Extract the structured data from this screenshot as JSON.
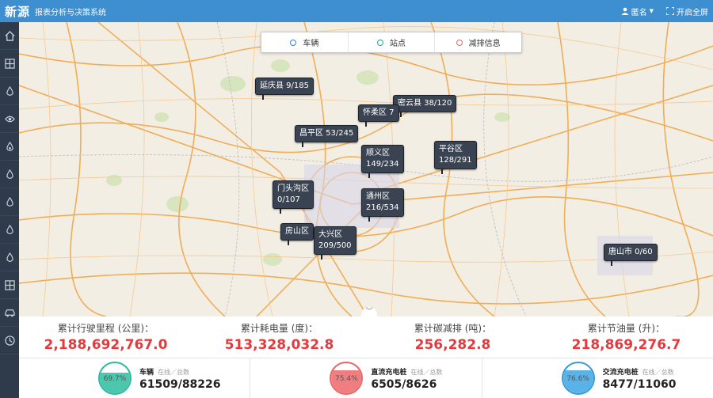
{
  "header": {
    "brand": "新源",
    "subtitle": "报表分析与决策系统",
    "user_label": "匿名",
    "fullscreen_label": "开启全屏"
  },
  "sidebar": {
    "items": [
      {
        "icon": "home-icon"
      },
      {
        "icon": "grid-icon"
      },
      {
        "icon": "drop-icon"
      },
      {
        "icon": "eye-icon"
      },
      {
        "icon": "drop-outline-icon"
      },
      {
        "icon": "drop-icon"
      },
      {
        "icon": "drop-icon"
      },
      {
        "icon": "drop-icon"
      },
      {
        "icon": "drop-icon"
      },
      {
        "icon": "grid-icon"
      },
      {
        "icon": "car-icon"
      },
      {
        "icon": "clock-icon"
      }
    ]
  },
  "legend": {
    "tabs": [
      {
        "label": "车辆",
        "color": "#3a7bd5"
      },
      {
        "label": "站点",
        "color": "#21a891"
      },
      {
        "label": "减排信息",
        "color": "#e8686a"
      }
    ]
  },
  "callouts": [
    {
      "line1": "延庆县 9/185",
      "line2": ""
    },
    {
      "line1": "密云县 38/120",
      "line2": ""
    },
    {
      "line1": "怀柔区 7",
      "line2": ""
    },
    {
      "line1": "昌平区 53/245",
      "line2": ""
    },
    {
      "line1": "顺义区",
      "line2": "149/234"
    },
    {
      "line1": "平谷区",
      "line2": "128/291"
    },
    {
      "line1": "门头沟区",
      "line2": "0/107"
    },
    {
      "line1": "通州区",
      "line2": "216/534"
    },
    {
      "line1": "房山区",
      "line2": ""
    },
    {
      "line1": "大兴区",
      "line2": "209/500"
    },
    {
      "line1": "唐山市 0/60",
      "line2": ""
    }
  ],
  "stats": [
    {
      "label": "累计行驶里程 (公里)：",
      "value": "2,188,692,767.0"
    },
    {
      "label": "累计耗电量 (度)：",
      "value": "513,328,032.8"
    },
    {
      "label": "累计碳减排 (吨)：",
      "value": "256,282.8"
    },
    {
      "label": "累计节油量 (升)：",
      "value": "218,869,276.7"
    }
  ],
  "cards": [
    {
      "title": "车辆",
      "sub": "在线／总数",
      "value": "61509/88226",
      "percent": "69.7%",
      "fill": 0.697,
      "color": "#2fb9a0",
      "fill_color": "#4cc7ae"
    },
    {
      "title": "直流充电桩",
      "sub": "在线／总数",
      "value": "6505/8626",
      "percent": "75.4%",
      "fill": 0.754,
      "color": "#e8686a",
      "fill_color": "#f07e80"
    },
    {
      "title": "交流充电桩",
      "sub": "在线／总数",
      "value": "8477/11060",
      "percent": "76.6%",
      "fill": 0.766,
      "color": "#3a9ad9",
      "fill_color": "#5ab3e8"
    }
  ]
}
